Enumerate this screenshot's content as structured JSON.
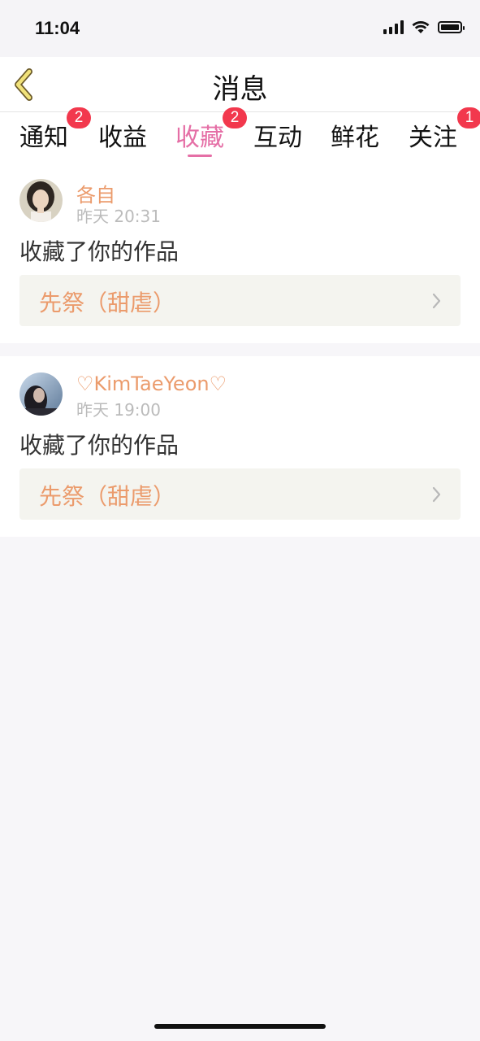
{
  "status_bar": {
    "time": "11:04"
  },
  "header": {
    "title": "消息"
  },
  "tabs": [
    {
      "label": "通知",
      "badge": "2"
    },
    {
      "label": "收益",
      "badge": ""
    },
    {
      "label": "收藏",
      "badge": "2",
      "active": true
    },
    {
      "label": "互动",
      "badge": ""
    },
    {
      "label": "鲜花",
      "badge": ""
    },
    {
      "label": "关注",
      "badge": "1"
    }
  ],
  "messages": [
    {
      "username": "各自",
      "time": "昨天 20:31",
      "action": "收藏了你的作品",
      "work_title": "先祭（甜虐）"
    },
    {
      "username": "♡KimTaeYeon♡",
      "time": "昨天 19:00",
      "action": "收藏了你的作品",
      "work_title": "先祭（甜虐）"
    }
  ],
  "colors": {
    "accent": "#e56fa6",
    "username": "#eb9b6c",
    "badge": "#f2384d",
    "back_arrow": "#f1e27a"
  },
  "icons": [
    "chevron-left-icon",
    "chevron-right-icon",
    "signal-icon",
    "wifi-icon",
    "battery-icon"
  ]
}
